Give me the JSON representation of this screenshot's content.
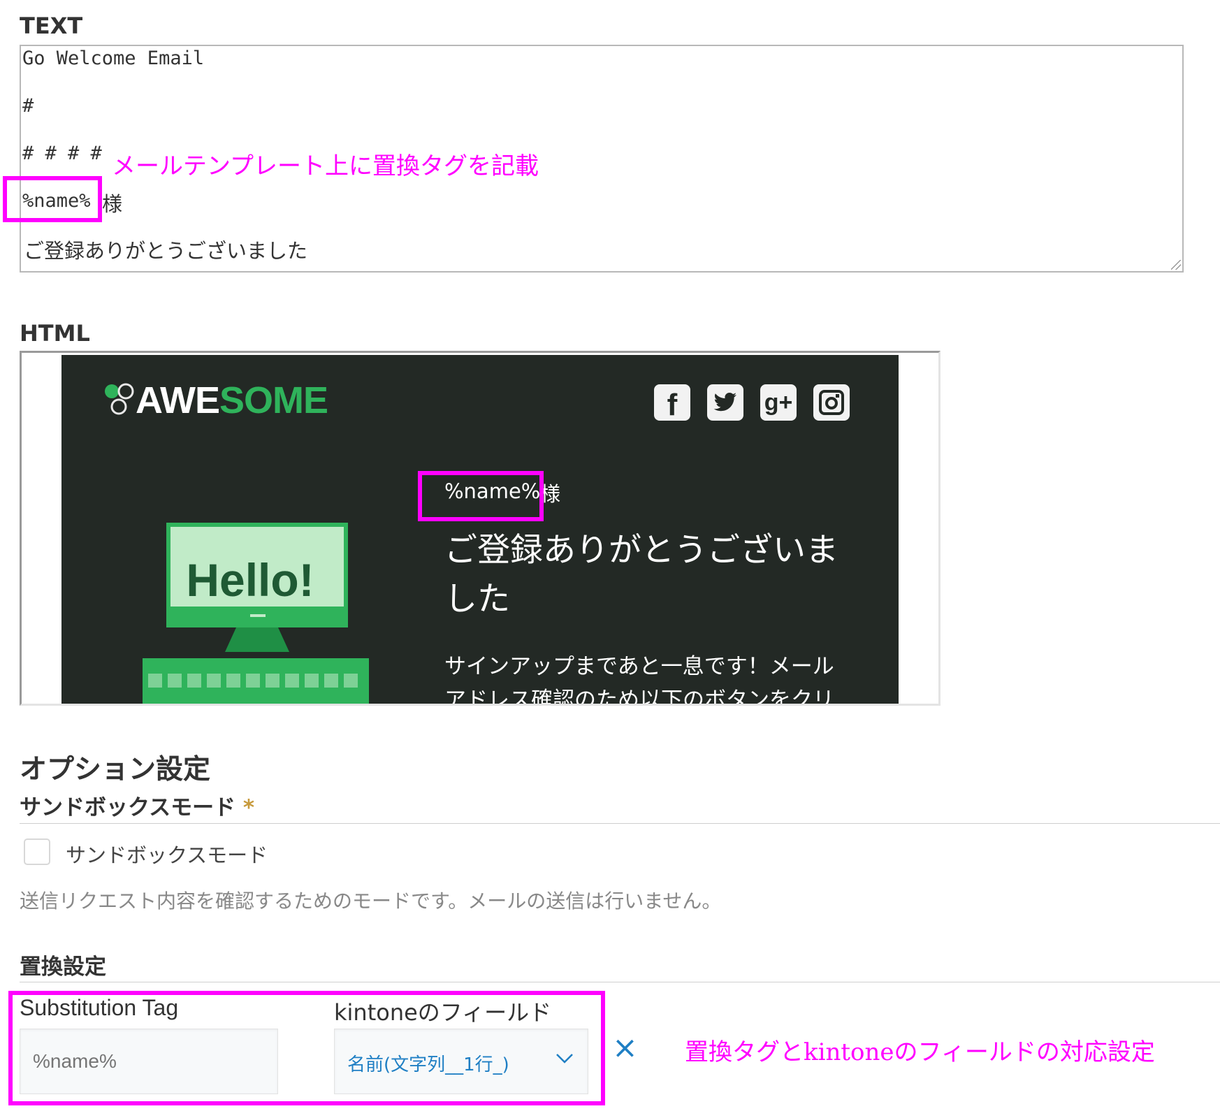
{
  "text_section": {
    "label": "TEXT",
    "lines": [
      "Go Welcome Email",
      "#",
      "# # # #",
      "%name%",
      "様",
      "ご登録ありがとうございました"
    ],
    "annotation": "メールテンプレート上に置換タグを記載"
  },
  "html_section": {
    "label": "HTML",
    "logo_white": "AWE",
    "logo_green": "SOME",
    "social_icons": [
      "facebook-icon",
      "twitter-icon",
      "google-plus-icon",
      "instagram-icon"
    ],
    "name_tag": "%name%",
    "honorific": "様",
    "heading_line1": "ご登録ありがとうございま",
    "heading_line2": "した",
    "body_line1": "サインアップまであと一息です！メール",
    "body_line2": "アドレス確認のため以下のボタンをクリ",
    "hello_text": "Hello!"
  },
  "options": {
    "title": "オプション設定",
    "sandbox_header": "サンドボックスモード",
    "required_mark": "*",
    "sandbox_checkbox_label": "サンドボックスモード",
    "sandbox_checked": false,
    "sandbox_help": "送信リクエスト内容を確認するためのモードです。メールの送信は行いません。"
  },
  "substitution": {
    "title": "置換設定",
    "tag_header": "Substitution Tag",
    "field_header": "kintoneのフィールド",
    "tag_placeholder": "%name%",
    "field_value": "名前(文字列__1行_)",
    "remove_symbol": "×",
    "annotation": "置換タグとkintoneのフィールドの対応設定"
  },
  "colors": {
    "annotation": "#ff00ff",
    "email_bg": "#232925",
    "brand_green": "#2fb35b",
    "link_blue": "#1f7fc4",
    "required_gold": "#c79a3c"
  }
}
